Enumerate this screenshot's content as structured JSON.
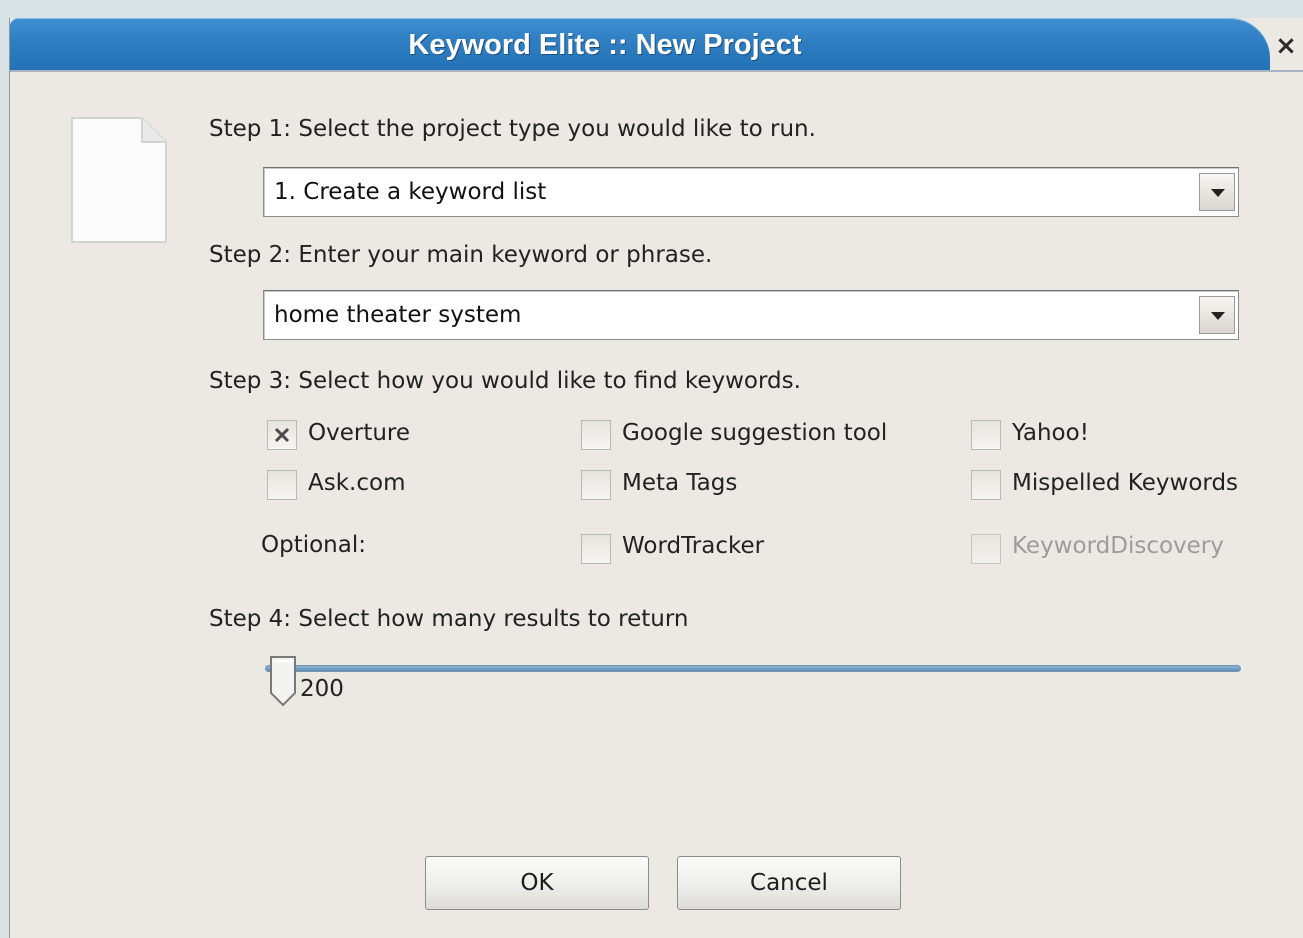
{
  "window": {
    "title": "Keyword Elite :: New Project",
    "close_glyph": "×"
  },
  "step1": {
    "label": "Step 1: Select the project type you would like to run.",
    "selected": "1. Create a keyword list"
  },
  "step2": {
    "label": "Step 2: Enter your main keyword or phrase.",
    "value": "home theater system"
  },
  "step3": {
    "label": "Step 3: Select how you would like to find keywords.",
    "optional_label": "Optional:",
    "options": [
      {
        "label": "Overture",
        "checked": true,
        "enabled": true
      },
      {
        "label": "Google suggestion tool",
        "checked": false,
        "enabled": true
      },
      {
        "label": "Yahoo!",
        "checked": false,
        "enabled": true
      },
      {
        "label": "Ask.com",
        "checked": false,
        "enabled": true
      },
      {
        "label": "Meta Tags",
        "checked": false,
        "enabled": true
      },
      {
        "label": "Mispelled Keywords",
        "checked": false,
        "enabled": true
      },
      {
        "label": "WordTracker",
        "checked": false,
        "enabled": true
      },
      {
        "label": "KeywordDiscovery",
        "checked": false,
        "enabled": false
      }
    ]
  },
  "step4": {
    "label": "Step 4: Select how many results to return",
    "value": "200"
  },
  "buttons": {
    "ok": "OK",
    "cancel": "Cancel"
  },
  "icons": {
    "doc": "document-icon",
    "combo_arrow": "chevron-down-icon",
    "check_mark": "x-mark-icon"
  }
}
